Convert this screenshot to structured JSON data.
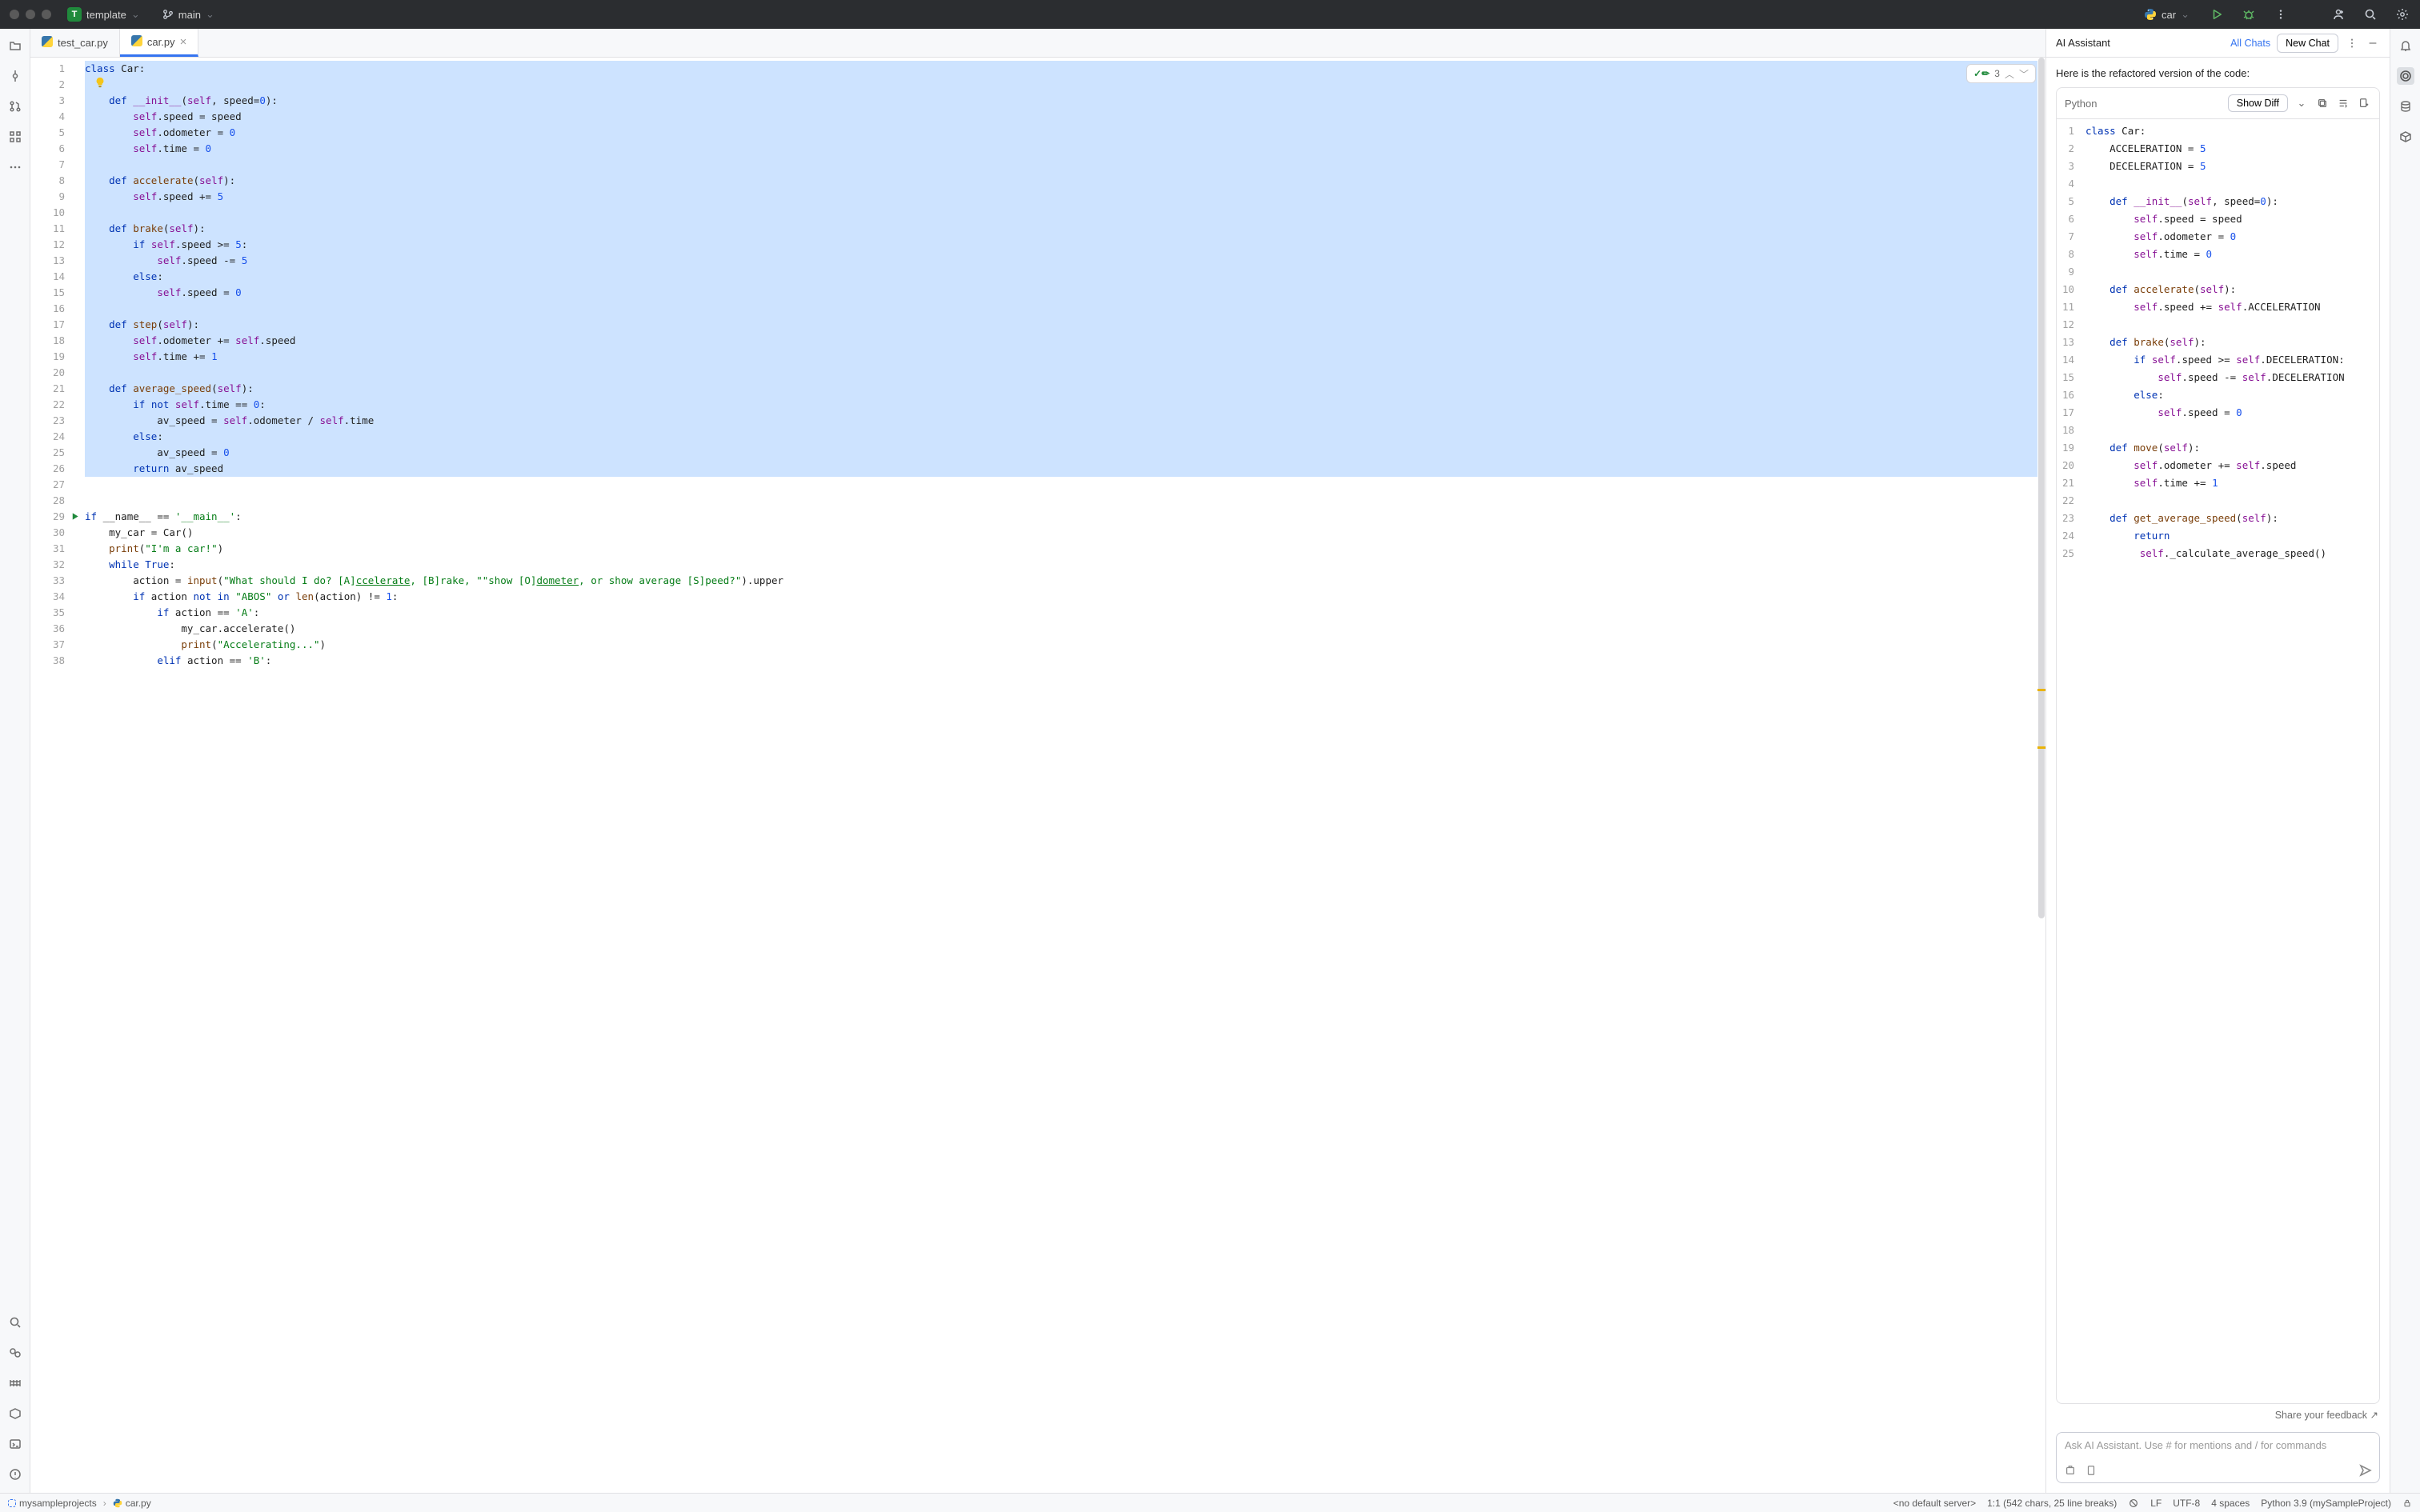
{
  "titlebar": {
    "project_badge": "T",
    "project_name": "template",
    "branch_name": "main",
    "run_config": "car"
  },
  "tabs": [
    {
      "label": "test_car.py",
      "active": false,
      "closeable": false
    },
    {
      "label": "car.py",
      "active": true,
      "closeable": true
    }
  ],
  "inspections": {
    "count": "3"
  },
  "editor": {
    "gutter_start": 1,
    "gutter_end": 38,
    "selected_through": 26,
    "run_gutter_line": 29,
    "lines_html": [
      "<span class='kw'>class</span> <span class='id'>Car</span>:",
      "",
      "    <span class='kw'>def</span> <span class='mag'>__init__</span>(<span class='slf'>self</span>, <span class='id'>speed</span>=<span class='num'>0</span>):",
      "        <span class='slf'>self</span>.speed = speed",
      "        <span class='slf'>self</span>.odometer = <span class='num'>0</span>",
      "        <span class='slf'>self</span>.time = <span class='num'>0</span>",
      "",
      "    <span class='kw'>def</span> <span class='fn'>accelerate</span>(<span class='slf'>self</span>):",
      "        <span class='slf'>self</span>.speed += <span class='num'>5</span>",
      "",
      "    <span class='kw'>def</span> <span class='fn'>brake</span>(<span class='slf'>self</span>):",
      "        <span class='kw'>if</span> <span class='slf'>self</span>.speed &gt;= <span class='num'>5</span>:",
      "            <span class='slf'>self</span>.speed -= <span class='num'>5</span>",
      "        <span class='kw'>else</span>:",
      "            <span class='slf'>self</span>.speed = <span class='num'>0</span>",
      "",
      "    <span class='kw'>def</span> <span class='fn'>step</span>(<span class='slf'>self</span>):",
      "        <span class='slf'>self</span>.odometer += <span class='slf'>self</span>.speed",
      "        <span class='slf'>self</span>.time += <span class='num'>1</span>",
      "",
      "    <span class='kw'>def</span> <span class='fn'>average_speed</span>(<span class='slf'>self</span>):",
      "        <span class='kw'>if</span> <span class='kw'>not</span> <span class='slf'>self</span>.time == <span class='num'>0</span>:",
      "            av_speed = <span class='slf'>self</span>.odometer / <span class='slf'>self</span>.time",
      "        <span class='kw'>else</span>:",
      "            av_speed = <span class='num'>0</span>",
      "        <span class='kw'>return</span> av_speed",
      "",
      "",
      "<span class='kw'>if</span> __name__ == <span class='str'>'__main__'</span>:",
      "    my_car = Car()",
      "    <span class='fn'>print</span>(<span class='str'>\"I'm a car!\"</span>)",
      "    <span class='kw'>while</span> <span class='kw'>True</span>:",
      "        action = <span class='fn'>input</span>(<span class='str'>\"What should I do? [A]<u>ccelerate</u>, [B]rake, \"\"show [O]<u>dometer</u>, or show average [S]peed?\"</span>).upper",
      "        <span class='kw'>if</span> action <span class='kw'>not</span> <span class='kw'>in</span> <span class='str'>\"ABOS\"</span> <span class='kw'>or</span> <span class='fn'>len</span>(action) != <span class='num'>1</span>:",
      "            <span class='kw'>if</span> action == <span class='str'>'A'</span>:",
      "                my_car.accelerate()",
      "                <span class='fn'>print</span>(<span class='str'>\"Accelerating...\"</span>)",
      "            <span class='kw'>elif</span> action == <span class='str'>'B'</span>:"
    ]
  },
  "ai": {
    "title": "AI Assistant",
    "all_chats": "All Chats",
    "new_chat": "New Chat",
    "intro": "Here is the refactored version of the code:",
    "lang": "Python",
    "show_diff": "Show Diff",
    "feedback": "Share your feedback ↗",
    "placeholder": "Ask AI Assistant. Use # for mentions and / for commands",
    "gutter_start": 1,
    "gutter_end": 25,
    "lines_html": [
      "<span class='kw'>class</span> <span class='id'>Car</span>:",
      "    ACCELERATION = <span class='num'>5</span>",
      "    DECELERATION = <span class='num'>5</span>",
      "",
      "    <span class='kw'>def</span> <span class='mag'>__init__</span>(<span class='slf'>self</span>, speed=<span class='num'>0</span>):",
      "        <span class='slf'>self</span>.speed = speed",
      "        <span class='slf'>self</span>.odometer = <span class='num'>0</span>",
      "        <span class='slf'>self</span>.time = <span class='num'>0</span>",
      "",
      "    <span class='kw'>def</span> <span class='fn'>accelerate</span>(<span class='slf'>self</span>):",
      "        <span class='slf'>self</span>.speed += <span class='slf'>self</span>.ACCELERATION",
      "",
      "    <span class='kw'>def</span> <span class='fn'>brake</span>(<span class='slf'>self</span>):",
      "        <span class='kw'>if</span> <span class='slf'>self</span>.speed &gt;= <span class='slf'>self</span>.DECELERATION:",
      "            <span class='slf'>self</span>.speed -= <span class='slf'>self</span>.DECELERATION",
      "        <span class='kw'>else</span>:",
      "            <span class='slf'>self</span>.speed = <span class='num'>0</span>",
      "",
      "    <span class='kw'>def</span> <span class='fn'>move</span>(<span class='slf'>self</span>):",
      "        <span class='slf'>self</span>.odometer += <span class='slf'>self</span>.speed",
      "        <span class='slf'>self</span>.time += <span class='num'>1</span>",
      "",
      "    <span class='kw'>def</span> <span class='fn'>get_average_speed</span>(<span class='slf'>self</span>):",
      "        <span class='kw'>return</span> ",
      "         <span class='slf'>self</span>._calculate_average_speed()",
      ""
    ]
  },
  "statusbar": {
    "breadcrumb_root": "mysampleprojects",
    "breadcrumb_file": "car.py",
    "server": "<no default server>",
    "caret": "1:1 (542 chars, 25 line breaks)",
    "line_sep": "LF",
    "encoding": "UTF-8",
    "indent": "4 spaces",
    "interpreter": "Python 3.9 (mySampleProject)"
  }
}
